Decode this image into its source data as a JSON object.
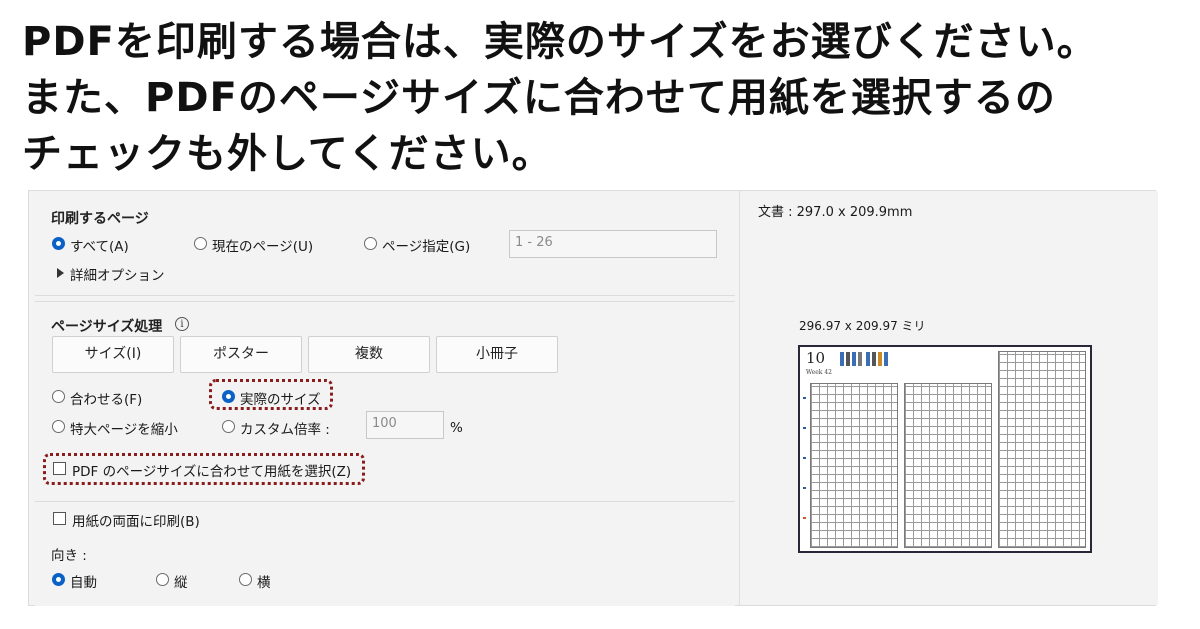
{
  "headline": {
    "line1": "PDFを印刷する場合は、実際のサイズをお選びください。",
    "line2": "また、PDFのページサイズに合わせて用紙を選択するの",
    "line3": "チェックも外してください。"
  },
  "print_pages": {
    "title": "印刷するページ",
    "options": [
      "すべて(A)",
      "現在のページ(U)",
      "ページ指定(G)"
    ],
    "selected": "すべて(A)",
    "range_value": "1 - 26",
    "more_options": "詳細オプション"
  },
  "page_sizing": {
    "title": "ページサイズ処理",
    "info_icon": "info-icon",
    "buttons": [
      "サイズ(I)",
      "ポスター",
      "複数",
      "小冊子"
    ],
    "fit": "合わせる(F)",
    "actual_size": "実際のサイズ",
    "shrink_oversized": "特大ページを縮小",
    "custom_scale": "カスタム倍率 :",
    "custom_scale_value": "100",
    "percent": "%",
    "choose_paper_by_pdf": "PDF のページサイズに合わせて用紙を選択(Z)"
  },
  "duplex": {
    "label": "用紙の両面に印刷(B)"
  },
  "orientation": {
    "title": "向き :",
    "options": [
      "自動",
      "縦",
      "横"
    ],
    "selected": "自動"
  },
  "preview": {
    "document_size": "文書 : 297.0 x 209.9mm",
    "paper_size": "296.97 x 209.97 ミリ",
    "day": "10",
    "week_label": "Week 42"
  },
  "colors": {
    "accent": "#0a62c7",
    "highlight": "#8a1c1c"
  }
}
